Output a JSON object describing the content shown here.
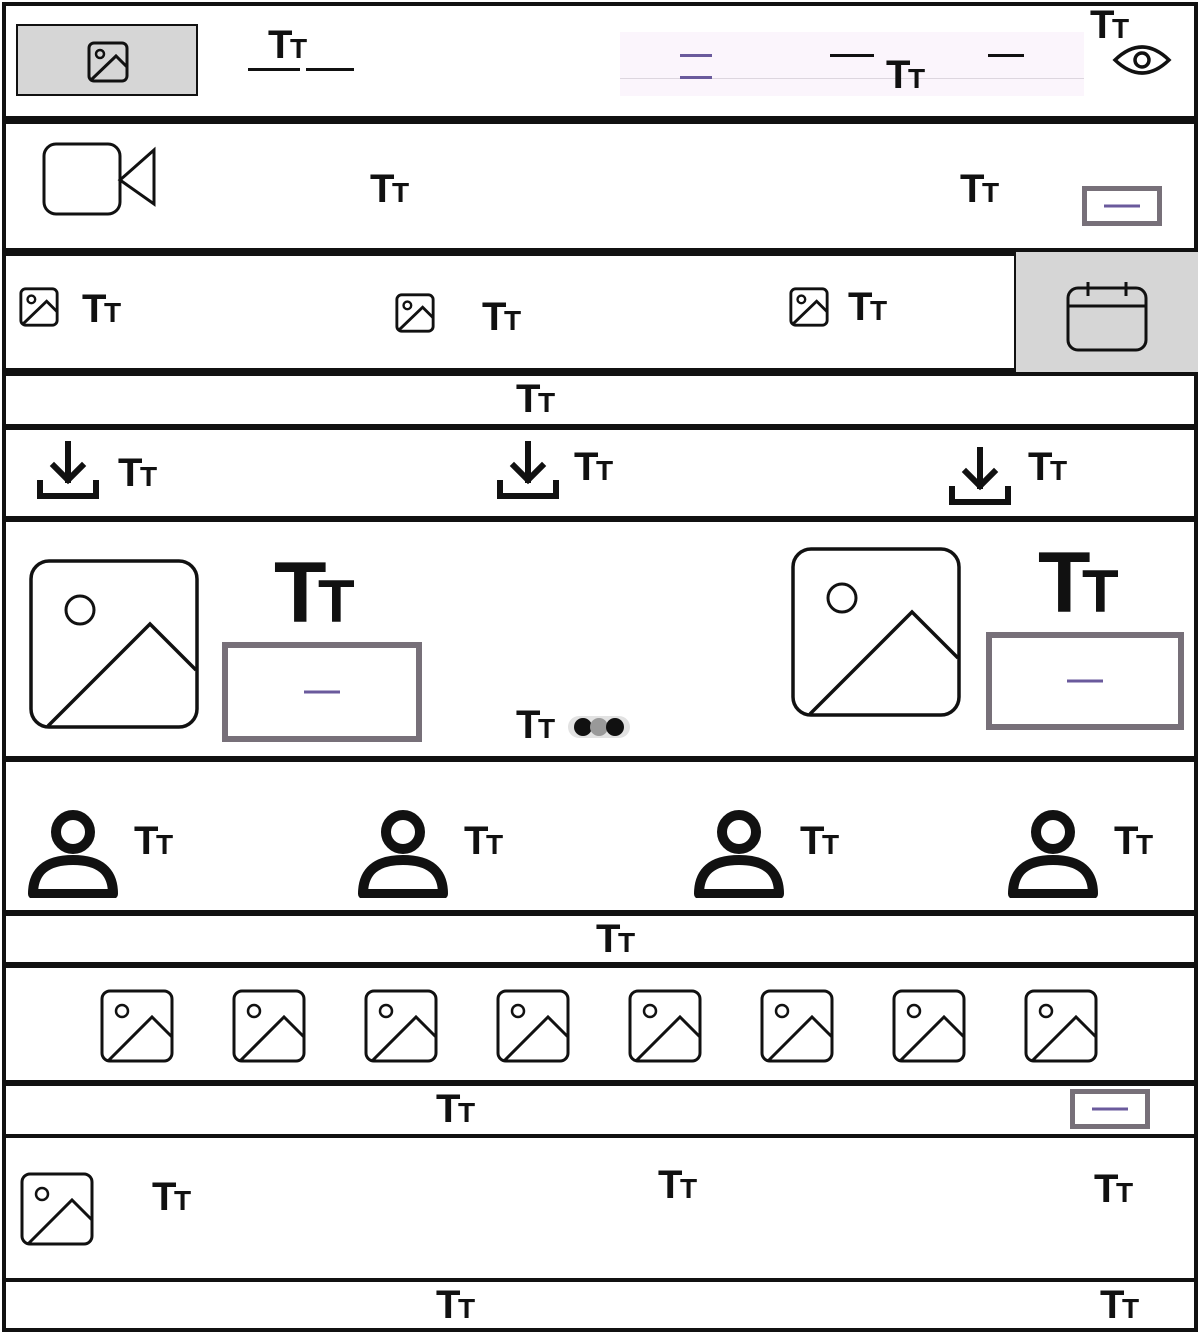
{
  "colors": {
    "border": "#111111",
    "accent_purple": "#6a5a9c",
    "button_outline": "#777079",
    "gray_fill": "#d6d6d6",
    "pinkish_bg": "#fbf5fc"
  },
  "icons": {
    "image": "image-icon",
    "video": "video-camera-icon",
    "calendar": "calendar-icon",
    "download": "download-icon",
    "user": "user-icon",
    "eye": "eye-icon",
    "text_placeholder": "text-icon"
  }
}
